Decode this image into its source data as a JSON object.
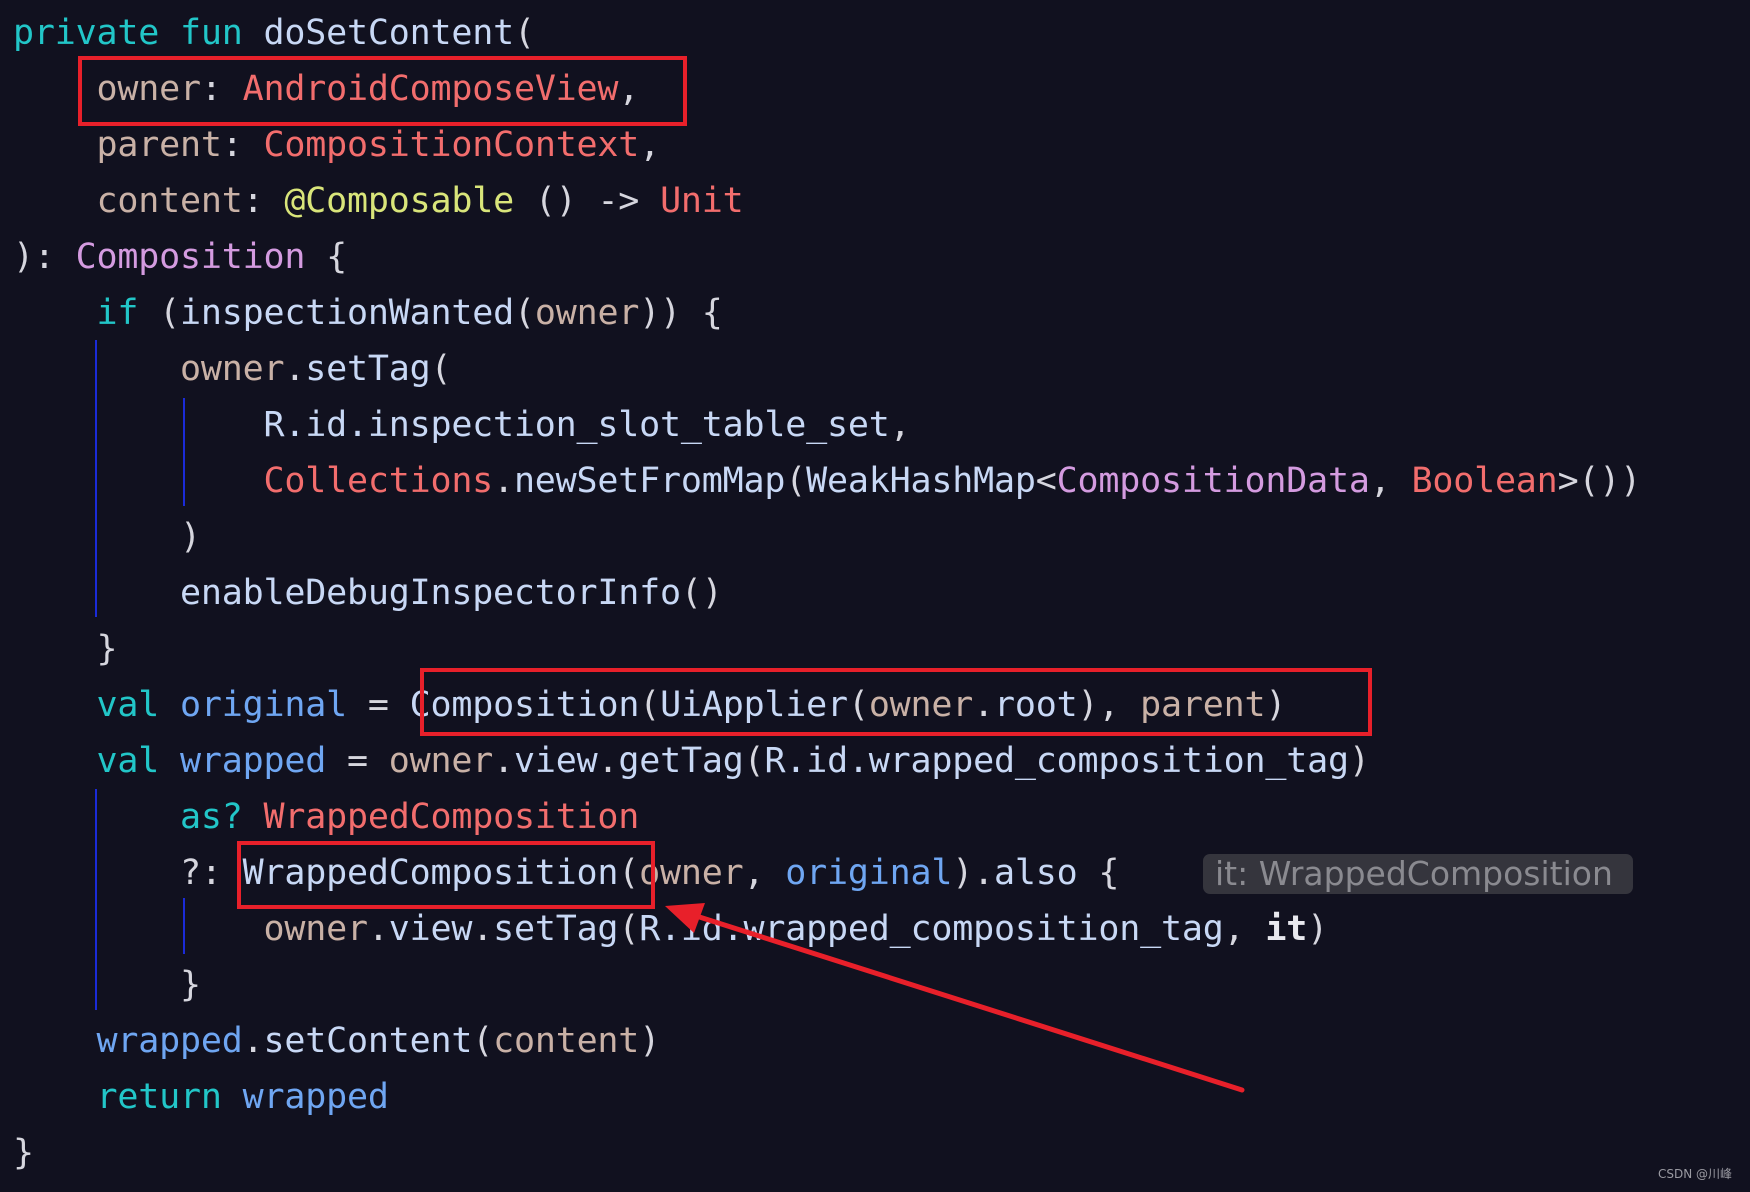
{
  "colors": {
    "background": "#11111f",
    "highlight_box": "#e8202a",
    "arrow": "#e8202a"
  },
  "lines": [
    [
      [
        "private ",
        "kw"
      ],
      [
        "fun ",
        "kw"
      ],
      [
        "doSetContent",
        "fn"
      ],
      [
        "(",
        "pl"
      ]
    ],
    [
      [
        "    ",
        "pl"
      ],
      [
        "owner",
        "pa"
      ],
      [
        ": ",
        "pl"
      ],
      [
        "AndroidComposeView",
        "ty"
      ],
      [
        ",",
        "pl"
      ]
    ],
    [
      [
        "    ",
        "pl"
      ],
      [
        "parent",
        "pa"
      ],
      [
        ": ",
        "pl"
      ],
      [
        "CompositionContext",
        "ty"
      ],
      [
        ",",
        "pl"
      ]
    ],
    [
      [
        "    ",
        "pl"
      ],
      [
        "content",
        "pa"
      ],
      [
        ": ",
        "pl"
      ],
      [
        "@Composable",
        "an"
      ],
      [
        " () -> ",
        "pl"
      ],
      [
        "Unit",
        "ty"
      ]
    ],
    [
      [
        "): ",
        "pl"
      ],
      [
        "Composition",
        "pu"
      ],
      [
        " {",
        "pl"
      ]
    ],
    [
      [
        "    ",
        "pl"
      ],
      [
        "if",
        "kw"
      ],
      [
        " (",
        "pl"
      ],
      [
        "inspectionWanted",
        "fn"
      ],
      [
        "(",
        "pl"
      ],
      [
        "owner",
        "pa"
      ],
      [
        ")) {",
        "pl"
      ]
    ],
    [
      [
        "        ",
        "pl"
      ],
      [
        "owner",
        "pa"
      ],
      [
        ".",
        "pl"
      ],
      [
        "setTag",
        "fn"
      ],
      [
        "(",
        "pl"
      ]
    ],
    [
      [
        "            ",
        "pl"
      ],
      [
        "R.id.inspection_slot_table_set",
        "fn"
      ],
      [
        ",",
        "pl"
      ]
    ],
    [
      [
        "            ",
        "pl"
      ],
      [
        "Collections",
        "ty"
      ],
      [
        ".",
        "pl"
      ],
      [
        "newSetFromMap",
        "fn"
      ],
      [
        "(",
        "pl"
      ],
      [
        "WeakHashMap",
        "fn"
      ],
      [
        "<",
        "pl"
      ],
      [
        "CompositionData",
        "pu"
      ],
      [
        ", ",
        "pl"
      ],
      [
        "Boolean",
        "ty"
      ],
      [
        ">())",
        "pl"
      ]
    ],
    [
      [
        "        )",
        "pl"
      ]
    ],
    [
      [
        "        ",
        "pl"
      ],
      [
        "enableDebugInspectorInfo",
        "fn"
      ],
      [
        "()",
        "pl"
      ]
    ],
    [
      [
        "    }",
        "pl"
      ]
    ],
    [
      [
        "    ",
        "pl"
      ],
      [
        "val ",
        "kw"
      ],
      [
        "original",
        "lv"
      ],
      [
        " = ",
        "pl"
      ],
      [
        "Composition",
        "fn"
      ],
      [
        "(",
        "pl"
      ],
      [
        "UiApplier",
        "fn"
      ],
      [
        "(",
        "pl"
      ],
      [
        "owner",
        "pa"
      ],
      [
        ".",
        "pl"
      ],
      [
        "root",
        "fn"
      ],
      [
        "), ",
        "pl"
      ],
      [
        "parent",
        "pa"
      ],
      [
        ")",
        "pl"
      ]
    ],
    [
      [
        "    ",
        "pl"
      ],
      [
        "val ",
        "kw"
      ],
      [
        "wrapped",
        "lv"
      ],
      [
        " = ",
        "pl"
      ],
      [
        "owner",
        "pa"
      ],
      [
        ".",
        "pl"
      ],
      [
        "view",
        "fn"
      ],
      [
        ".",
        "pl"
      ],
      [
        "getTag",
        "fn"
      ],
      [
        "(",
        "pl"
      ],
      [
        "R.id.wrapped_composition_tag",
        "fn"
      ],
      [
        ")",
        "pl"
      ]
    ],
    [
      [
        "        ",
        "pl"
      ],
      [
        "as?",
        "kw"
      ],
      [
        " ",
        "pl"
      ],
      [
        "WrappedComposition",
        "ty"
      ]
    ],
    [
      [
        "        ?: ",
        "pl"
      ],
      [
        "WrappedComposition",
        "fn"
      ],
      [
        "(",
        "pl"
      ],
      [
        "owner",
        "pa"
      ],
      [
        ", ",
        "pl"
      ],
      [
        "original",
        "lv"
      ],
      [
        ").",
        "pl"
      ],
      [
        "also",
        "fn"
      ],
      [
        " {",
        "pl"
      ]
    ],
    [
      [
        "            ",
        "pl"
      ],
      [
        "owner",
        "pa"
      ],
      [
        ".",
        "pl"
      ],
      [
        "view",
        "fn"
      ],
      [
        ".",
        "pl"
      ],
      [
        "setTag",
        "fn"
      ],
      [
        "(",
        "pl"
      ],
      [
        "R.id.wrapped_composition_tag",
        "fn"
      ],
      [
        ", ",
        "pl"
      ],
      [
        "it",
        "bd"
      ],
      [
        ")",
        "pl"
      ]
    ],
    [
      [
        "        }",
        "pl"
      ]
    ],
    [
      [
        "    ",
        "pl"
      ],
      [
        "wrapped",
        "lv"
      ],
      [
        ".",
        "pl"
      ],
      [
        "setContent",
        "fn"
      ],
      [
        "(",
        "pl"
      ],
      [
        "content",
        "pa"
      ],
      [
        ")",
        "pl"
      ]
    ],
    [
      [
        "    ",
        "pl"
      ],
      [
        "return ",
        "kw"
      ],
      [
        "wrapped",
        "lv"
      ]
    ],
    [
      [
        "}",
        "pl"
      ]
    ]
  ],
  "inlay_hint": "it: WrappedComposition",
  "watermark": "CSDN @川峰"
}
